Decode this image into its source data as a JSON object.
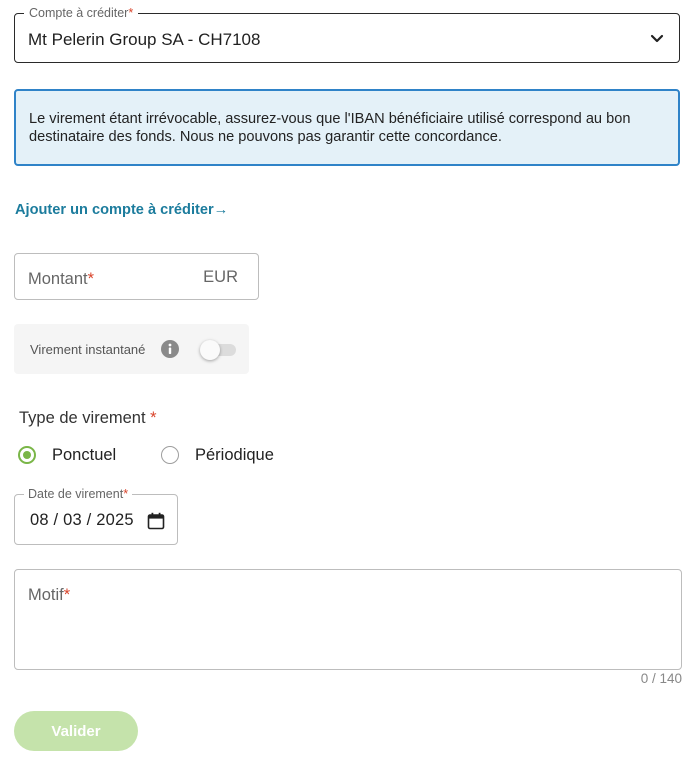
{
  "account": {
    "label": "Compte à créditer",
    "required_mark": "*",
    "value": "Mt Pelerin Group SA - CH7108",
    "icon": "chevron-down-icon"
  },
  "info_banner": {
    "text": "Le virement étant irrévocable, assurez-vous que l'IBAN bénéficiaire utilisé correspond au bon destinataire des fonds. Nous ne pouvons pas garantir cette concordance.",
    "border_color": "#2f83c8",
    "background": "#e4f1f8"
  },
  "add_account_link": "Ajouter un compte à créditer→",
  "amount": {
    "label": "Montant",
    "required_mark": "*",
    "currency": "EUR",
    "value": ""
  },
  "instant_transfer": {
    "label": "Virement instantané",
    "info_icon": "info-icon",
    "enabled": false
  },
  "transfer_type": {
    "title": "Type de virement",
    "required_mark": "*",
    "options": [
      {
        "label": "Ponctuel",
        "checked": true
      },
      {
        "label": "Périodique",
        "checked": false
      }
    ],
    "accent_color": "#7ab648"
  },
  "date": {
    "label": "Date de virement",
    "required_mark": "*",
    "value": "08 / 03 / 2025",
    "icon": "calendar-icon"
  },
  "motif": {
    "label": "Motif",
    "required_mark": "*",
    "value": "",
    "counter": "0 / 140"
  },
  "submit": {
    "label": "Valider",
    "background": "#c5e3ab",
    "disabled": true
  },
  "colors": {
    "link": "#1c7c9d",
    "required": "#d9442b"
  }
}
